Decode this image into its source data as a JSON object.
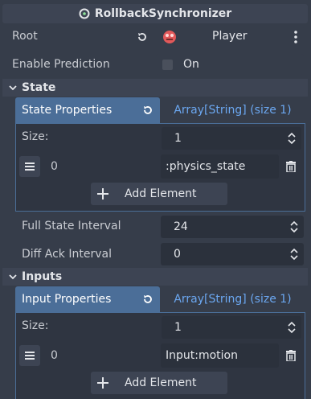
{
  "header": {
    "title": "RollbackSynchronizer",
    "icon": "node-icon"
  },
  "root": {
    "label": "Root",
    "value": "Player",
    "icon": "scene-node-icon"
  },
  "prediction": {
    "label": "Enable Prediction",
    "value": "On",
    "checked": false
  },
  "state": {
    "section_title": "State",
    "tab_label": "State Properties",
    "tab_type": "Array[String] (size 1)",
    "size_label": "Size:",
    "size_value": "1",
    "items": [
      {
        "index": "0",
        "value": ":physics_state"
      }
    ],
    "add_label": "Add Element"
  },
  "full_state_interval": {
    "label": "Full State Interval",
    "value": "24"
  },
  "diff_ack_interval": {
    "label": "Diff Ack Interval",
    "value": "0"
  },
  "inputs": {
    "section_title": "Inputs",
    "tab_label": "Input Properties",
    "tab_type": "Array[String] (size 1)",
    "size_label": "Size:",
    "size_value": "1",
    "items": [
      {
        "index": "0",
        "value": "Input:motion"
      }
    ],
    "add_label": "Add Element"
  },
  "colors": {
    "background": "#363d4a",
    "field": "#2b313c",
    "accent": "#4b6e98",
    "link": "#6ba7f0"
  }
}
